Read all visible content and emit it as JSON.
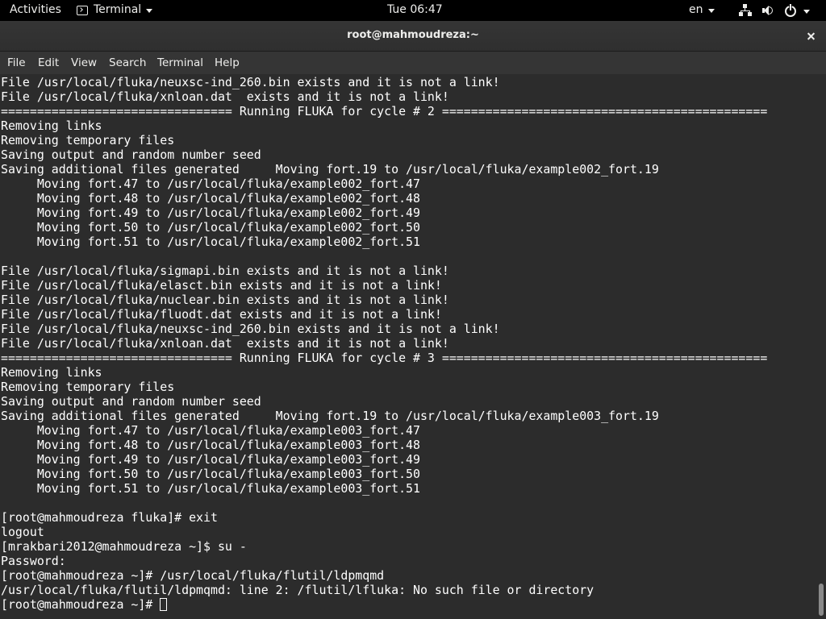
{
  "topbar": {
    "activities": "Activities",
    "app_name": "Terminal",
    "clock": "Tue 06:47",
    "language": "en",
    "icons": {
      "app": "terminal-icon",
      "network": "network-icon",
      "volume": "volume-icon",
      "power": "power-icon"
    }
  },
  "window": {
    "title": "root@mahmoudreza:~",
    "close_icon": "close-icon"
  },
  "menubar": {
    "file": "File",
    "edit": "Edit",
    "view": "View",
    "search": "Search",
    "terminal": "Terminal",
    "help": "Help"
  },
  "terminal": {
    "lines": [
      "File /usr/local/fluka/neuxsc-ind_260.bin exists and it is not a link!",
      "File /usr/local/fluka/xnloan.dat  exists and it is not a link!",
      "================================ Running FLUKA for cycle # 2 =============================================",
      "Removing links",
      "Removing temporary files",
      "Saving output and random number seed",
      "Saving additional files generated     Moving fort.19 to /usr/local/fluka/example002_fort.19",
      "     Moving fort.47 to /usr/local/fluka/example002_fort.47",
      "     Moving fort.48 to /usr/local/fluka/example002_fort.48",
      "     Moving fort.49 to /usr/local/fluka/example002_fort.49",
      "     Moving fort.50 to /usr/local/fluka/example002_fort.50",
      "     Moving fort.51 to /usr/local/fluka/example002_fort.51",
      "",
      "File /usr/local/fluka/sigmapi.bin exists and it is not a link!",
      "File /usr/local/fluka/elasct.bin exists and it is not a link!",
      "File /usr/local/fluka/nuclear.bin exists and it is not a link!",
      "File /usr/local/fluka/fluodt.dat exists and it is not a link!",
      "File /usr/local/fluka/neuxsc-ind_260.bin exists and it is not a link!",
      "File /usr/local/fluka/xnloan.dat  exists and it is not a link!",
      "================================ Running FLUKA for cycle # 3 =============================================",
      "Removing links",
      "Removing temporary files",
      "Saving output and random number seed",
      "Saving additional files generated     Moving fort.19 to /usr/local/fluka/example003_fort.19",
      "     Moving fort.47 to /usr/local/fluka/example003_fort.47",
      "     Moving fort.48 to /usr/local/fluka/example003_fort.48",
      "     Moving fort.49 to /usr/local/fluka/example003_fort.49",
      "     Moving fort.50 to /usr/local/fluka/example003_fort.50",
      "     Moving fort.51 to /usr/local/fluka/example003_fort.51",
      "",
      "[root@mahmoudreza fluka]# exit",
      "logout",
      "[mrakbari2012@mahmoudreza ~]$ su -",
      "Password:",
      "[root@mahmoudreza ~]# /usr/local/fluka/flutil/ldpmqmd",
      "/usr/local/fluka/flutil/ldpmqmd: line 2: /flutil/lfluka: No such file or directory"
    ],
    "prompt": "[root@mahmoudreza ~]# "
  }
}
